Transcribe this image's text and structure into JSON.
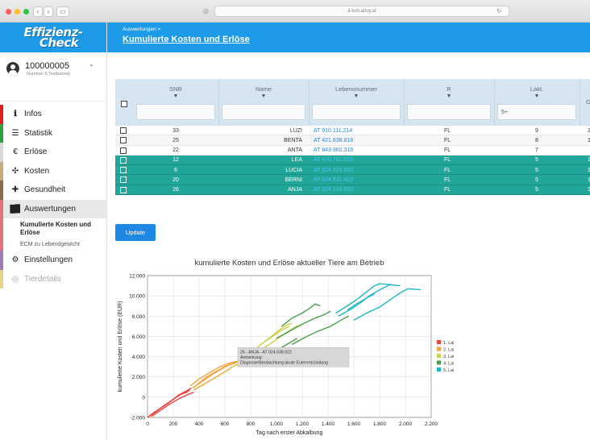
{
  "browser": {
    "url": "ä kuh.at/uy.at",
    "reload_icon": "↻",
    "shield_icon": "◎"
  },
  "app": {
    "brand_line1": "Effizienz-",
    "brand_line2": "Check"
  },
  "account": {
    "number": "100000005",
    "subtitle": "Nummer 5 Testbetrieb"
  },
  "sidebar": {
    "items": [
      {
        "label": "Infos",
        "icon": "ℹ",
        "color": "#e02020"
      },
      {
        "label": "Statistik",
        "icon": "☰",
        "color": "#2e9e3e"
      },
      {
        "label": "Erlöse",
        "icon": "€",
        "color": "#d7d7d7"
      },
      {
        "label": "Kosten",
        "icon": "✣",
        "color": "#c9a97d"
      },
      {
        "label": "Gesundheit",
        "icon": "✚",
        "color": "#8b6c4a"
      },
      {
        "label": "Auswertungen",
        "icon": "▐",
        "color": "#e2737b"
      },
      {
        "label": "Einstellungen",
        "icon": "⚙",
        "color": "#9b7bb5"
      },
      {
        "label": "Tierdetails",
        "icon": "◎",
        "color": "#e8d28a"
      }
    ],
    "sub_items": [
      {
        "label": "Kumulierte Kosten und Erlöse"
      },
      {
        "label": "ECM zu Lebendgewicht"
      }
    ]
  },
  "header": {
    "breadcrumb": "Auswertungen >",
    "title": "Kumulierte Kosten und Erlöse"
  },
  "table": {
    "columns": [
      {
        "label": "SNR",
        "filter": ""
      },
      {
        "label": "Name",
        "filter": ""
      },
      {
        "label": "Lebensnummer",
        "filter": ""
      },
      {
        "label": "R",
        "filter": ""
      },
      {
        "label": "Lakt.",
        "filter": "5+"
      },
      {
        "label": "G",
        "filter": ""
      }
    ],
    "filter_icon": "▼",
    "rows": [
      {
        "snr": "33",
        "name": "LUZI",
        "ln": "AT 910.111.214",
        "r": "FL",
        "lakt": "9",
        "g": "1",
        "selected": false
      },
      {
        "snr": "25",
        "name": "BENTA",
        "ln": "AT 421.838.818",
        "r": "FL",
        "lakt": "8",
        "g": "1",
        "selected": false
      },
      {
        "snr": "22",
        "name": "ANTA",
        "ln": "AT 843.960.318",
        "r": "FL",
        "lakt": "7",
        "g": "",
        "selected": false
      },
      {
        "snr": "12",
        "name": "LEA",
        "ln": "AT 470.781.019",
        "r": "FL",
        "lakt": "5",
        "g": "1",
        "selected": true
      },
      {
        "snr": "6",
        "name": "LUCIA",
        "ln": "AT 024.625.922",
        "r": "FL",
        "lakt": "5",
        "g": "1",
        "selected": true
      },
      {
        "snr": "20",
        "name": "BERNI",
        "ln": "AT 024.631.422",
        "r": "FL",
        "lakt": "5",
        "g": "1",
        "selected": true
      },
      {
        "snr": "26",
        "name": "ANJA",
        "ln": "AT 024.638.922",
        "r": "FL",
        "lakt": "5",
        "g": "1",
        "selected": true
      }
    ]
  },
  "buttons": {
    "update": "Update"
  },
  "chart_data": {
    "type": "line",
    "title": "kumulierte Kosten und Erlöse aktueller Tiere am Betrieb",
    "xlabel": "Tag nach erster Abkalbung",
    "ylabel": "kumulierte Kosten und Erlöse (EUR)",
    "xlim": [
      0,
      2200
    ],
    "ylim": [
      -2000,
      12000
    ],
    "xticks": [
      0,
      200,
      400,
      600,
      800,
      1000,
      1200,
      1400,
      1600,
      1800,
      2000,
      2200
    ],
    "xtick_labels": [
      "0",
      "200",
      "400",
      "600",
      "800",
      "1.000",
      "1.200",
      "1.400",
      "1.600",
      "1.800",
      "2.000",
      "2.200"
    ],
    "yticks": [
      -2000,
      0,
      2000,
      4000,
      6000,
      8000,
      10000,
      12000
    ],
    "ytick_labels": [
      "-2.000",
      "0",
      "2.000",
      "4.000",
      "6.000",
      "8.000",
      "10.000",
      "12.000"
    ],
    "grid": true,
    "legend_position": "right",
    "series": [
      {
        "name": "1. Laktation",
        "color": "#e8433a",
        "lines": [
          [
            [
              0,
              -2000
            ],
            [
              60,
              -1500
            ],
            [
              120,
              -900
            ],
            [
              180,
              -400
            ],
            [
              240,
              200
            ],
            [
              300,
              600
            ],
            [
              340,
              900
            ]
          ],
          [
            [
              20,
              -1800
            ],
            [
              90,
              -1200
            ],
            [
              160,
              -600
            ],
            [
              220,
              0
            ],
            [
              280,
              400
            ],
            [
              330,
              700
            ]
          ],
          [
            [
              40,
              -1600
            ],
            [
              110,
              -1000
            ],
            [
              190,
              -300
            ],
            [
              260,
              300
            ],
            [
              310,
              500
            ]
          ],
          [
            [
              30,
              -1900
            ],
            [
              100,
              -1300
            ],
            [
              170,
              -700
            ],
            [
              250,
              -100
            ],
            [
              320,
              300
            ],
            [
              360,
              500
            ]
          ]
        ]
      },
      {
        "name": "2. Laktation",
        "color": "#f3a33a",
        "lines": [
          [
            [
              330,
              1100
            ],
            [
              400,
              1800
            ],
            [
              480,
              2400
            ],
            [
              560,
              3000
            ],
            [
              620,
              3300
            ],
            [
              680,
              3500
            ],
            [
              720,
              3600
            ]
          ],
          [
            [
              350,
              900
            ],
            [
              430,
              1600
            ],
            [
              510,
              2300
            ],
            [
              590,
              2900
            ],
            [
              650,
              3300
            ],
            [
              700,
              3500
            ]
          ],
          [
            [
              360,
              700
            ],
            [
              440,
              1300
            ],
            [
              520,
              1900
            ],
            [
              600,
              2500
            ],
            [
              660,
              3000
            ],
            [
              710,
              3300
            ]
          ],
          [
            [
              380,
              1200
            ],
            [
              460,
              2000
            ],
            [
              540,
              2600
            ],
            [
              610,
              3100
            ],
            [
              690,
              3400
            ]
          ]
        ]
      },
      {
        "name": "3. Laktation",
        "color": "#c9d34a",
        "lines": [
          [
            [
              700,
              3500
            ],
            [
              780,
              4200
            ],
            [
              860,
              5000
            ],
            [
              940,
              5800
            ],
            [
              1000,
              6400
            ],
            [
              1060,
              7000
            ],
            [
              1120,
              7300
            ]
          ],
          [
            [
              740,
              3800
            ],
            [
              820,
              4600
            ],
            [
              900,
              5400
            ],
            [
              980,
              6100
            ],
            [
              1040,
              6600
            ],
            [
              1100,
              7000
            ]
          ],
          [
            [
              760,
              3600
            ],
            [
              840,
              4300
            ],
            [
              920,
              5000
            ],
            [
              1000,
              5700
            ],
            [
              1080,
              6400
            ],
            [
              1140,
              6900
            ],
            [
              1180,
              7100
            ]
          ],
          [
            [
              640,
              2900
            ],
            [
              720,
              3300
            ],
            [
              800,
              3800
            ],
            [
              880,
              4500
            ],
            [
              940,
              5200
            ]
          ]
        ]
      },
      {
        "name": "4. Laktation",
        "color": "#4a9e4a",
        "lines": [
          [
            [
              1040,
              7000
            ],
            [
              1120,
              7800
            ],
            [
              1200,
              8300
            ],
            [
              1260,
              8800
            ],
            [
              1300,
              9200
            ],
            [
              1340,
              9000
            ]
          ],
          [
            [
              1000,
              5800
            ],
            [
              1100,
              6500
            ],
            [
              1200,
              7200
            ],
            [
              1300,
              7800
            ],
            [
              1380,
              8200
            ],
            [
              1420,
              8500
            ]
          ],
          [
            [
              1120,
              5200
            ],
            [
              1220,
              5900
            ],
            [
              1320,
              6500
            ],
            [
              1420,
              7000
            ],
            [
              1500,
              7600
            ],
            [
              1560,
              8000
            ]
          ],
          [
            [
              920,
              4100
            ],
            [
              1000,
              4600
            ],
            [
              1080,
              5200
            ],
            [
              1160,
              5800
            ]
          ]
        ]
      },
      {
        "name": "5. Laktation",
        "color": "#1fb5c4",
        "lines": [
          [
            [
              1460,
              8300
            ],
            [
              1560,
              9100
            ],
            [
              1640,
              9800
            ],
            [
              1700,
              10400
            ],
            [
              1760,
              11000
            ],
            [
              1800,
              11200
            ],
            [
              1900,
              11100
            ]
          ],
          [
            [
              1480,
              8000
            ],
            [
              1580,
              8700
            ],
            [
              1660,
              9400
            ],
            [
              1720,
              10000
            ],
            [
              1800,
              10600
            ],
            [
              1880,
              11100
            ],
            [
              1960,
              11000
            ]
          ],
          [
            [
              1600,
              7600
            ],
            [
              1700,
              8300
            ],
            [
              1800,
              8900
            ],
            [
              1880,
              9600
            ],
            [
              1960,
              10300
            ],
            [
              2020,
              10700
            ],
            [
              2120,
              10600
            ]
          ],
          [
            [
              1550,
              8600
            ],
            [
              1620,
              9200
            ],
            [
              1700,
              9800
            ],
            [
              1760,
              10200
            ]
          ]
        ]
      }
    ],
    "tooltip": {
      "line1": "26 - ANJA - AT 024.638.922",
      "line2": "Anmerkung:",
      "line3": "Diagnose/Beobachtung:akute Euterentzündung"
    }
  }
}
